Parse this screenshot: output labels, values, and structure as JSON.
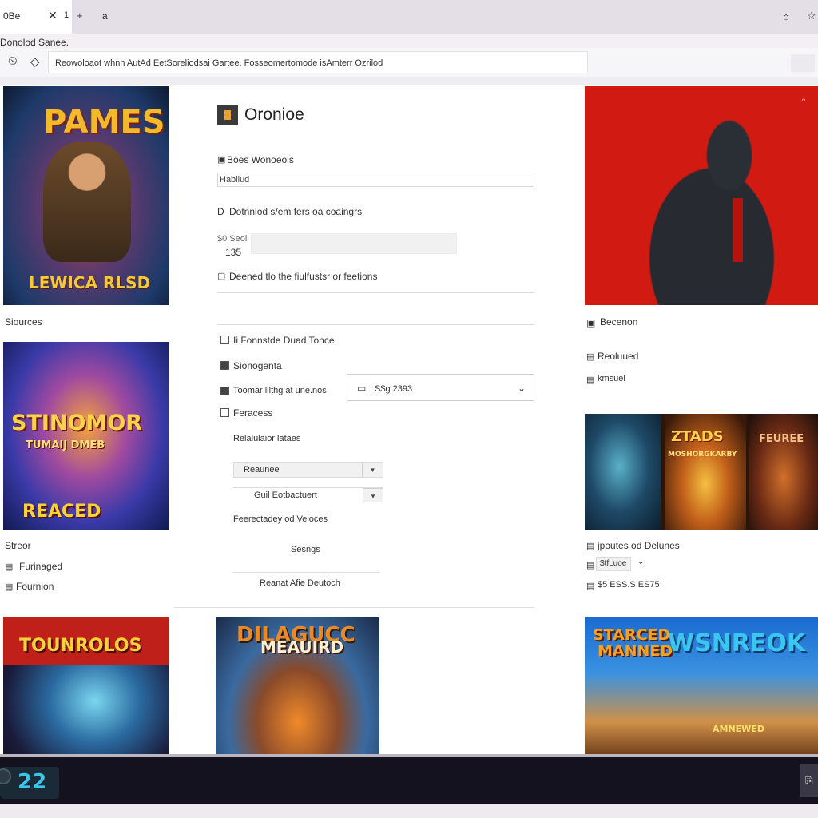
{
  "tabbar": {
    "tab_title": "0Be",
    "tab_close_glyph": "✕",
    "tab_num": "1",
    "new_tab_glyph": "+",
    "tab_icon_glyph": "a",
    "right_icon1": "⌂",
    "right_icon2": "☆"
  },
  "window": {
    "title": "Donolod Sanee."
  },
  "addressbar": {
    "history_icon": "⏲",
    "nav_icon": "◇",
    "url": "Reowoloaot whnh AutAd EetSoreliodsai Gartee. Fosseomertomode isAmterr Ozrilod"
  },
  "thumbnails": {
    "t1": {
      "title": "PAMES",
      "subtitle": "LEWICA RLSD"
    },
    "t3": {
      "title": "STINOMOR",
      "tag": "TUMAIJ DMEB",
      "subtitle": "REACED"
    },
    "t4": {
      "title": "ZTADS",
      "sub": "MOSHORGKARBY",
      "right": "FEUREE"
    },
    "t5": {
      "title": "TOUNROLOS"
    },
    "t6": {
      "title": "DILAGUCC",
      "sub": "MEAUIRD"
    },
    "t7": {
      "left1": "STARCED",
      "left2": "MANNED",
      "right": "WSNREOK",
      "badge": "AMNEWED"
    }
  },
  "left_labels": {
    "sources": "Siources",
    "streor": "Streor",
    "furinaged": "Furinaged",
    "fournion": "Fournion"
  },
  "center": {
    "title": "Oronioe",
    "section1_label": "Boes Wonoeols",
    "section1_value": "Habilud",
    "section2_label": "Dotnnlod s/em fers oa coaingrs",
    "section3_label": "$0 Seol",
    "section3_value": "135",
    "section4_label": "Deened tlo the fiulfustsr or feetions",
    "cb1_label": "Ii Fonnstde Duad Tonce",
    "cb2_label": "Sionogenta",
    "cb3_label": "Toomar lilthg at une.nos",
    "cb3_select": "S$g 2393",
    "cb4_label": "Feracess",
    "sub_label": "Relalulaior lataes",
    "dropdown1": "Reaunee",
    "dropdown2": "Guil Eotbactuert",
    "sub_label2": "Feerectadey od Veloces",
    "sub_label3": "Sesngs",
    "footer_link": "Reanat Afie Deutoch"
  },
  "right_labels": {
    "r1": "Becenon",
    "r2": "Reoluued",
    "r3": "kmsuel",
    "r4": "jpoutes od Delunes",
    "r5_select": "$tfLuoe",
    "r6": "$5 ESS.S ES75"
  },
  "bottombar": {
    "logo_text": "22",
    "right_glyph": "⎘"
  }
}
